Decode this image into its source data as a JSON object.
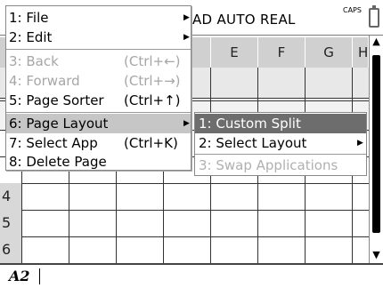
{
  "statusbar": {
    "mode_text": "AD  AUTO  REAL",
    "caps_label": "CAPS",
    "battery_icon": "battery-icon"
  },
  "sheet": {
    "columns": [
      "E",
      "F",
      "G",
      "H"
    ],
    "rows": [
      "4",
      "5",
      "6"
    ]
  },
  "entry": {
    "cell_ref": "A2"
  },
  "menu": {
    "items": [
      {
        "label": "1: File",
        "shortcut": "",
        "submenu": true,
        "disabled": false
      },
      {
        "label": "2: Edit",
        "shortcut": "",
        "submenu": true,
        "disabled": false
      },
      {
        "label": "3: Back",
        "shortcut": "(Ctrl+←)",
        "submenu": false,
        "disabled": true
      },
      {
        "label": "4: Forward",
        "shortcut": "(Ctrl+→)",
        "submenu": false,
        "disabled": true
      },
      {
        "label": "5: Page Sorter",
        "shortcut": "(Ctrl+↑)",
        "submenu": false,
        "disabled": false
      },
      {
        "label": "6: Page Layout",
        "shortcut": "",
        "submenu": true,
        "disabled": false,
        "selected": true
      },
      {
        "label": "7: Select App",
        "shortcut": "(Ctrl+K)",
        "submenu": false,
        "disabled": false
      },
      {
        "label": "8: Delete Page",
        "shortcut": "",
        "submenu": false,
        "disabled": false
      }
    ]
  },
  "submenu": {
    "items": [
      {
        "label": "1: Custom Split",
        "highlight": true,
        "submenu": false,
        "disabled": false
      },
      {
        "label": "2: Select Layout",
        "highlight": false,
        "submenu": true,
        "disabled": false
      },
      {
        "label": "3: Swap Applications",
        "highlight": false,
        "submenu": false,
        "disabled": true
      }
    ]
  }
}
